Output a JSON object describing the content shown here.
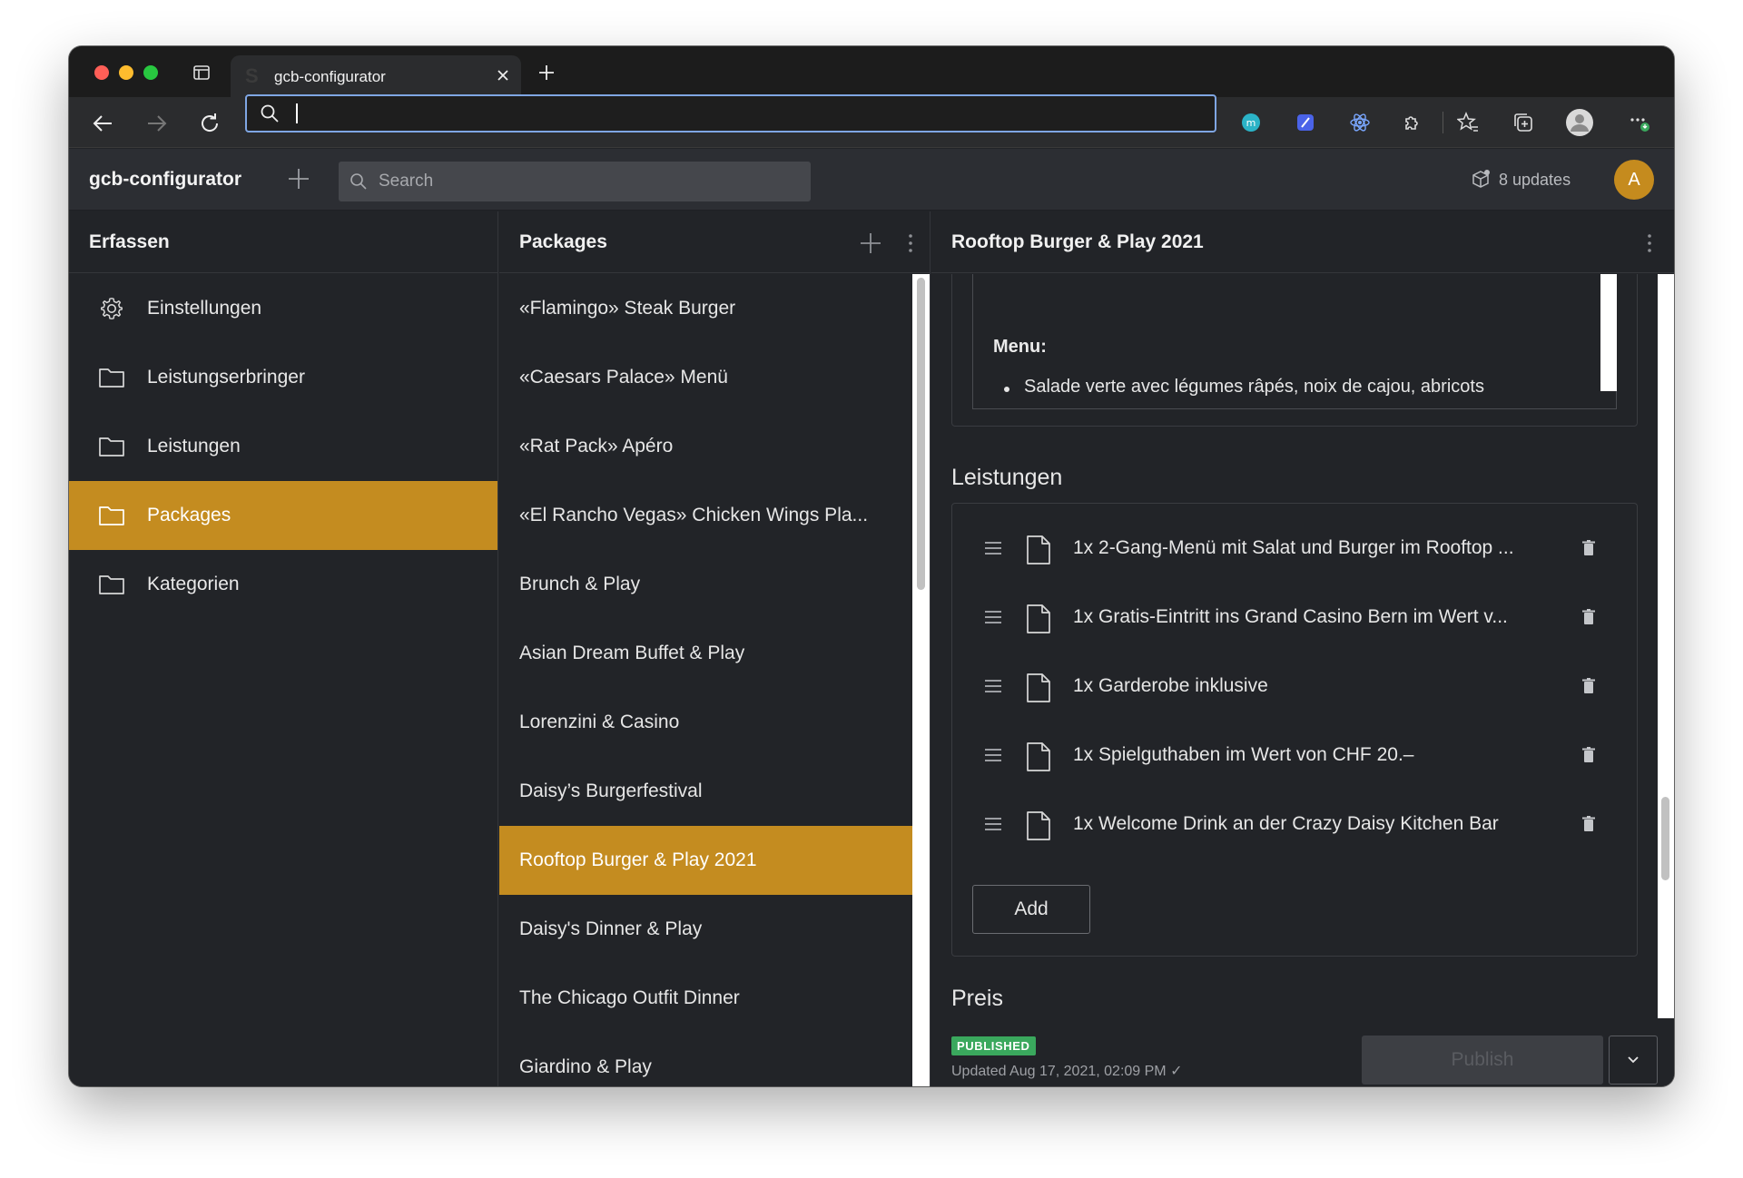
{
  "browser": {
    "tab_title": "gcb-configurator",
    "address_value": "",
    "extensions": [
      "meet-icon",
      "feather-icon",
      "react-devtools-icon",
      "puzzle-icon"
    ],
    "toolbar_icons": [
      "favorites-star-icon",
      "collections-icon",
      "profile-icon",
      "more-icon"
    ]
  },
  "app": {
    "title": "gcb-configurator",
    "search_placeholder": "Search",
    "updates_label": "8 updates",
    "avatar_initial": "A",
    "accent_color": "#c48c20"
  },
  "left_pane": {
    "title": "Erfassen",
    "items": [
      {
        "label": "Einstellungen",
        "icon": "gear-icon"
      },
      {
        "label": "Leistungserbringer",
        "icon": "folder-icon"
      },
      {
        "label": "Leistungen",
        "icon": "folder-icon"
      },
      {
        "label": "Packages",
        "icon": "folder-icon",
        "active": true
      },
      {
        "label": "Kategorien",
        "icon": "folder-icon"
      }
    ]
  },
  "packages_pane": {
    "title": "Packages",
    "items": [
      "«Flamingo» Steak Burger",
      "«Caesars Palace» Menü",
      "«Rat Pack» Apéro",
      "«El Rancho Vegas» Chicken Wings Pla...",
      "Brunch & Play",
      "Asian Dream Buffet & Play",
      "Lorenzini & Casino",
      "Daisy’s Burgerfestival",
      "Rooftop Burger & Play 2021",
      "Daisy's Dinner & Play",
      "The Chicago Outfit Dinner",
      "Giardino & Play"
    ],
    "active_index": 8
  },
  "detail": {
    "title": "Rooftop Burger & Play 2021",
    "menu_label": "Menu:",
    "menu_items": [
      "Salade verte avec légumes râpés, noix de cajou, abricots"
    ],
    "leistungen_title": "Leistungen",
    "leistungen": [
      "1x 2-Gang-Menü mit Salat und Burger im Rooftop ...",
      "1x Gratis-Eintritt ins Grand Casino Bern im Wert v...",
      "1x Garderobe inklusive",
      "1x Spielguthaben im Wert von CHF 20.–",
      "1x Welcome Drink an der Crazy Daisy Kitchen Bar"
    ],
    "add_label": "Add",
    "preis_title": "Preis",
    "status_badge": "PUBLISHED",
    "updated_text": "Updated Aug 17, 2021, 02:09 PM ✓",
    "publish_label": "Publish"
  }
}
